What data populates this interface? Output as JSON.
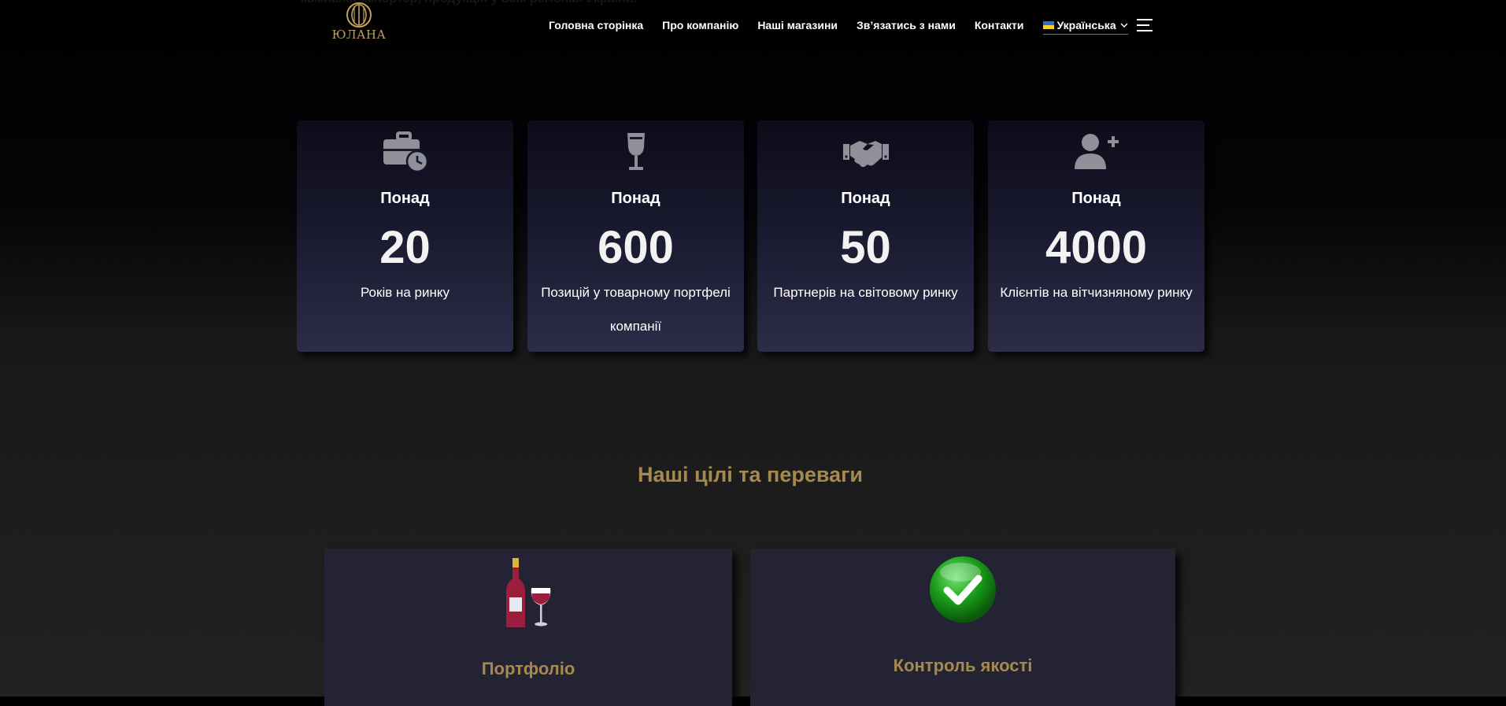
{
  "header": {
    "ghost_text": "компанія-імпортер, продукція у всіх регіонах України.",
    "logo_text": "ЮЛАНА",
    "nav": [
      {
        "label": "Головна сторінка"
      },
      {
        "label": "Про компанію"
      },
      {
        "label": "Наші магазини"
      },
      {
        "label": "Зв’язатись з нами"
      },
      {
        "label": "Контакти"
      }
    ],
    "language": "Українська",
    "icons": {
      "flag": "ukraine-flag-icon",
      "chevron": "chevron-down-icon",
      "menu": "hamburger-menu-icon"
    }
  },
  "stats": [
    {
      "icon": "briefcase-clock-icon",
      "prefix": "Понад",
      "value": "20",
      "label": "Років на ринку"
    },
    {
      "icon": "wine-glass-icon",
      "prefix": "Понад",
      "value": "600",
      "label": "Позицій у товарному портфелі компанії"
    },
    {
      "icon": "handshake-icon",
      "prefix": "Понад",
      "value": "50",
      "label": "Партнерів на світовому ринку"
    },
    {
      "icon": "user-plus-icon",
      "prefix": "Понад",
      "value": "4000",
      "label": "Клієнтів на вітчизняному ринку"
    }
  ],
  "section": {
    "title": "Наші цілі та переваги",
    "features": [
      {
        "icon": "wine-bottle-glass-icon",
        "title": "Портфоліо"
      },
      {
        "icon": "green-check-icon",
        "title": "Контроль якості"
      }
    ]
  },
  "colors": {
    "accent_gold": "#a6894f",
    "logo_gold": "#c2a15c",
    "card_top": "#0c0c1a",
    "card_bottom": "#2c2c48",
    "icon_gray": "#8f9098",
    "wine_red": "#9b1f3c",
    "check_green": "#1a9e1a"
  }
}
